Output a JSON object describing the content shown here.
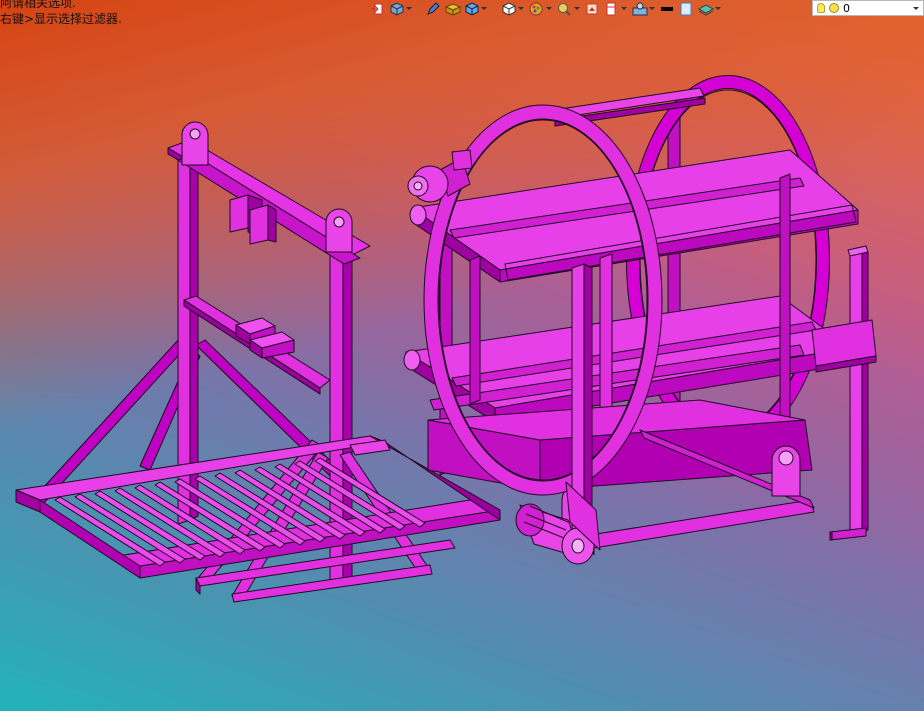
{
  "hint": {
    "line1": "阿请相关选项.",
    "line2": "右键>显示选择过滤器."
  },
  "toolbar": {
    "icons": [
      "exit-sketch-icon",
      "view-orientation-icon",
      "edit-icon",
      "section-view-icon",
      "display-style-icon",
      "view-cube-icon",
      "appearance-icon",
      "zoom-icon",
      "scene-icon",
      "view-setting-icon",
      "render-tools-icon",
      "line-color-icon",
      "background-icon",
      "layer-icon"
    ],
    "lights_value": "0"
  },
  "colors": {
    "model": "#d400d4",
    "edge": "#1e0a22"
  }
}
